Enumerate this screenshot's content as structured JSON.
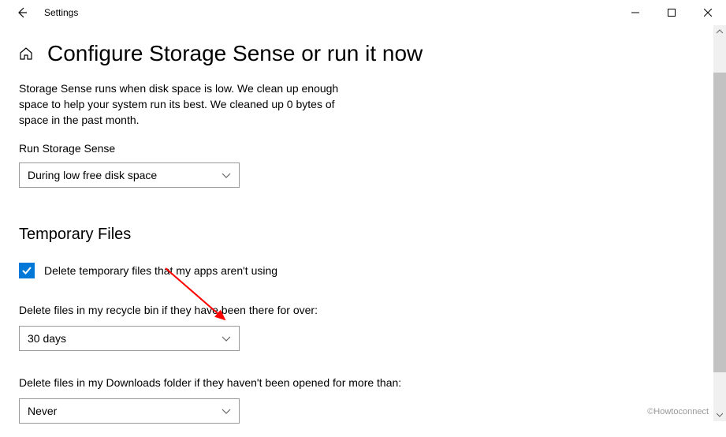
{
  "titlebar": {
    "title": "Settings"
  },
  "page": {
    "title": "Configure Storage Sense or run it now",
    "description": "Storage Sense runs when disk space is low. We clean up enough space to help your system run its best. We cleaned up 0 bytes of space in the past month."
  },
  "runSense": {
    "label": "Run Storage Sense",
    "value": "During low free disk space"
  },
  "tempFiles": {
    "sectionTitle": "Temporary Files",
    "checkboxLabel": "Delete temporary files that my apps aren't using",
    "checkboxChecked": true,
    "recycleBin": {
      "label": "Delete files in my recycle bin if they have been there for over:",
      "value": "30 days"
    },
    "downloads": {
      "label": "Delete files in my Downloads folder if they haven't been opened for more than:",
      "value": "Never"
    }
  },
  "watermark": "©Howtoconnect"
}
